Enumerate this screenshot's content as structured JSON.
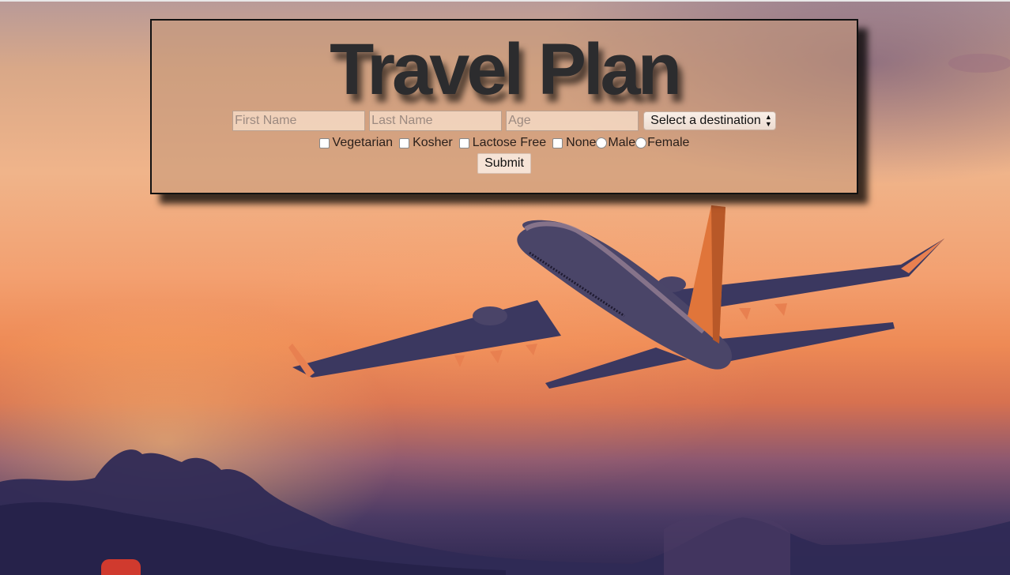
{
  "page": {
    "title": "Travel Plan"
  },
  "form": {
    "first_name_placeholder": "First Name",
    "last_name_placeholder": "Last Name",
    "age_placeholder": "Age",
    "destination_select": {
      "selected": "Select a destination"
    },
    "dietary_options": [
      {
        "label": "Vegetarian",
        "checked": false
      },
      {
        "label": "Kosher",
        "checked": false
      },
      {
        "label": "Lactose Free",
        "checked": false
      },
      {
        "label": "None",
        "checked": false
      }
    ],
    "gender_options": [
      {
        "label": "Male",
        "selected": false
      },
      {
        "label": "Female",
        "selected": false
      }
    ],
    "submit_label": "Submit"
  },
  "background": {
    "scene": "airplane-sunset",
    "colors": {
      "sky_top": "#b89a98",
      "sky_mid": "#f0b48a",
      "sky_low": "#ee8a55",
      "clouds": "#2d2750",
      "plane_body": "#3e3a5a",
      "plane_tail": "#e0753a"
    }
  }
}
